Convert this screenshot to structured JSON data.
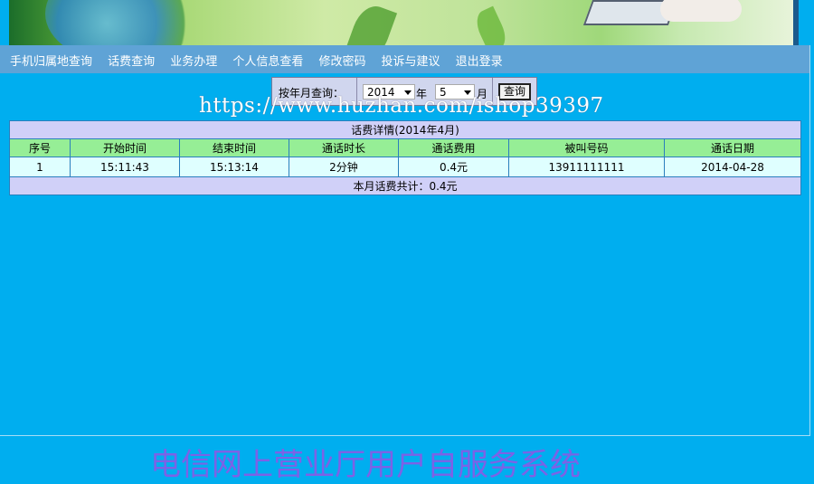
{
  "nav": {
    "items": [
      "手机归属地查询",
      "话费查询",
      "业务办理",
      "个人信息查看",
      "修改密码",
      "投诉与建议",
      "退出登录"
    ]
  },
  "query": {
    "label": "按年月查询：",
    "year_value": "2014",
    "year_unit": "年",
    "month_value": "5",
    "month_unit": "月",
    "button_label": "查询"
  },
  "watermark": "https://www.huzhan.com/ishop39397",
  "table": {
    "title": "话费详情(2014年4月)",
    "columns": [
      "序号",
      "开始时间",
      "结束时间",
      "通话时长",
      "通话费用",
      "被叫号码",
      "通话日期"
    ],
    "rows": [
      [
        "1",
        "15:11:43",
        "15:13:14",
        "2分钟",
        "0.4元",
        "13911111111",
        "2014-04-28"
      ]
    ],
    "total": "本月话费共计：0.4元"
  },
  "footer": {
    "title": "电信网上营业厅用户自服务系统"
  },
  "colors": {
    "background": "#00aeef",
    "nav_bar": "#5fa3d6",
    "table_header": "#96ee96",
    "table_title": "#d0d0f8",
    "table_row": "#dfffff",
    "footer_title": "#8a5ae6"
  }
}
